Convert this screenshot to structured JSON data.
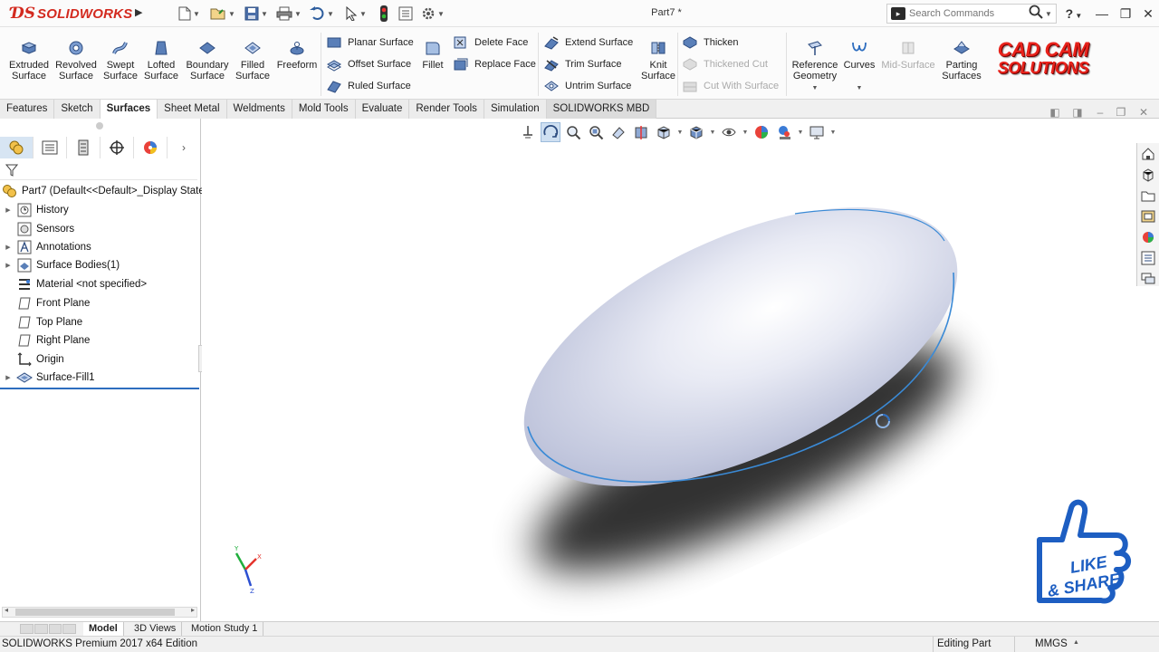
{
  "app": {
    "brand": "SOLIDWORKS",
    "doc_title": "Part7 *",
    "search_placeholder": "Search Commands",
    "help_label": "?"
  },
  "ribbon": {
    "big_buttons": [
      {
        "label1": "Extruded",
        "label2": "Surface"
      },
      {
        "label1": "Revolved",
        "label2": "Surface"
      },
      {
        "label1": "Swept",
        "label2": "Surface"
      },
      {
        "label1": "Lofted",
        "label2": "Surface"
      },
      {
        "label1": "Boundary",
        "label2": "Surface"
      },
      {
        "label1": "Filled",
        "label2": "Surface"
      },
      {
        "label1": "Freeform",
        "label2": ""
      }
    ],
    "planar": "Planar Surface",
    "offset": "Offset Surface",
    "ruled": "Ruled Surface",
    "fillet": "Fillet",
    "delete_face": "Delete Face",
    "replace_face": "Replace Face",
    "extend": "Extend Surface",
    "trim": "Trim Surface",
    "untrim": "Untrim Surface",
    "knit1": "Knit",
    "knit2": "Surface",
    "thicken": "Thicken",
    "thickened_cut": "Thickened Cut",
    "cut_with_surface": "Cut With Surface",
    "reference1": "Reference",
    "reference2": "Geometry",
    "curves": "Curves",
    "mid_surface": "Mid-Surface",
    "parting1": "Parting",
    "parting2": "Surfaces",
    "watermark_line1": "CAD CAM",
    "watermark_line2": "SOLUTIONS"
  },
  "tabs": [
    "Features",
    "Sketch",
    "Surfaces",
    "Sheet Metal",
    "Weldments",
    "Mold Tools",
    "Evaluate",
    "Render Tools",
    "Simulation",
    "SOLIDWORKS MBD"
  ],
  "active_tab": "Surfaces",
  "tree": {
    "root": "Part7  (Default<<Default>_Display State",
    "items": [
      {
        "label": "History",
        "expandable": true
      },
      {
        "label": "Sensors",
        "expandable": false
      },
      {
        "label": "Annotations",
        "expandable": true
      },
      {
        "label": "Surface Bodies(1)",
        "expandable": true
      },
      {
        "label": "Material <not specified>",
        "expandable": false
      },
      {
        "label": "Front Plane",
        "expandable": false
      },
      {
        "label": "Top Plane",
        "expandable": false
      },
      {
        "label": "Right Plane",
        "expandable": false
      },
      {
        "label": "Origin",
        "expandable": false
      },
      {
        "label": "Surface-Fill1",
        "expandable": true
      }
    ]
  },
  "bottom_tabs": [
    "Model",
    "3D Views",
    "Motion Study 1"
  ],
  "status": {
    "edition": "SOLIDWORKS Premium 2017 x64 Edition",
    "mode": "Editing Part",
    "units": "MMGS"
  },
  "overlay": {
    "like": "LIKE",
    "share": "& SHARE"
  },
  "triad": {
    "x": "X",
    "y": "Y",
    "z": "Z"
  },
  "colors": {
    "brand_red": "#d32a1f",
    "selection_blue": "#2d6dbf",
    "surface_edge": "#3a8ad6",
    "like_blue": "#1d5ec2"
  }
}
